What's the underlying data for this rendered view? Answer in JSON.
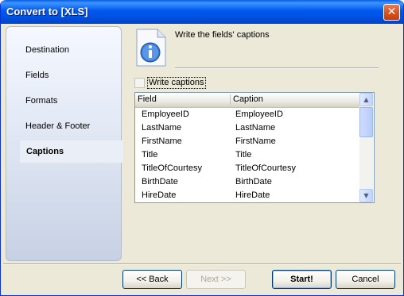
{
  "window": {
    "title": "Convert to [XLS]"
  },
  "sidebar": {
    "items": [
      {
        "label": "Destination"
      },
      {
        "label": "Fields"
      },
      {
        "label": "Formats"
      },
      {
        "label": "Header & Footer"
      },
      {
        "label": "Captions",
        "active": true
      }
    ]
  },
  "main": {
    "heading": "Write the fields' captions",
    "icon": "info-icon",
    "write_captions": {
      "label": "Write captions",
      "checked": false
    },
    "grid": {
      "columns": [
        "Field",
        "Caption"
      ],
      "rows": [
        [
          "EmployeeID",
          "EmployeeID"
        ],
        [
          "LastName",
          "LastName"
        ],
        [
          "FirstName",
          "FirstName"
        ],
        [
          "Title",
          "Title"
        ],
        [
          "TitleOfCourtesy",
          "TitleOfCourtesy"
        ],
        [
          "BirthDate",
          "BirthDate"
        ],
        [
          "HireDate",
          "HireDate"
        ]
      ]
    }
  },
  "footer": {
    "back": "<< Back",
    "next": "Next >>",
    "start": "Start!",
    "cancel": "Cancel"
  },
  "colors": {
    "titlebar": "#0058ee",
    "close": "#d8501e",
    "window_bg": "#ece9d8"
  }
}
